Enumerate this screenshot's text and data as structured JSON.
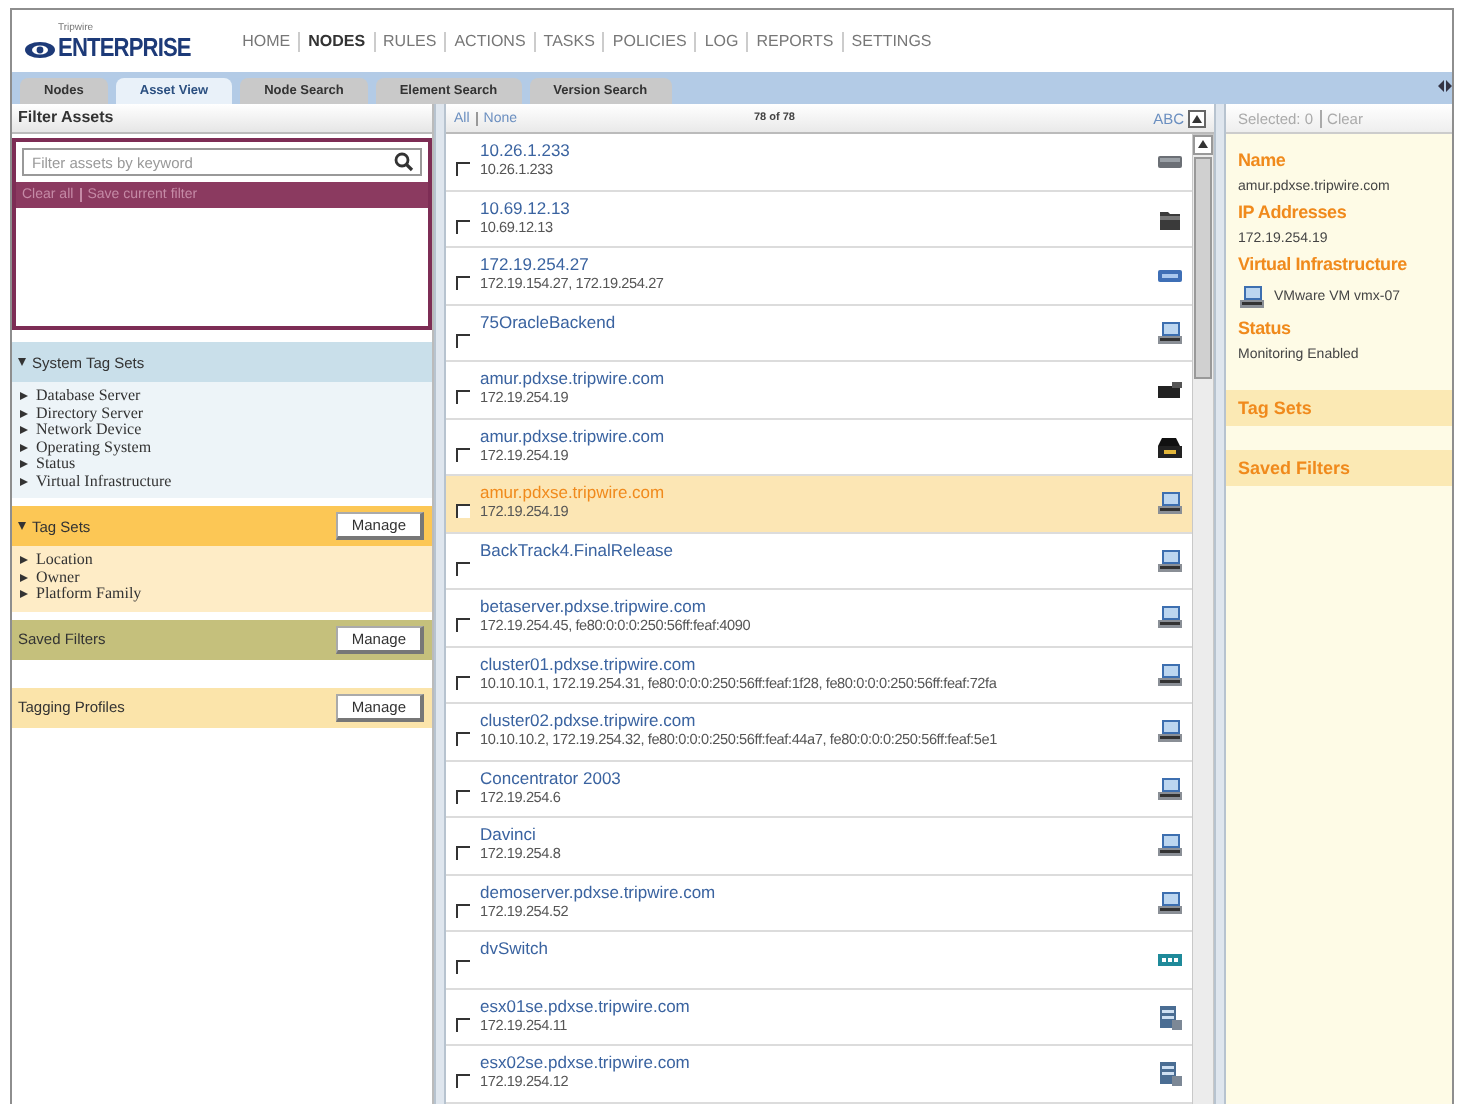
{
  "header": {
    "brand_small": "Tripwire",
    "brand": "ENTERPRISE",
    "nav": [
      {
        "label": "HOME",
        "selected": false
      },
      {
        "label": "NODES",
        "selected": true
      },
      {
        "label": "RULES",
        "selected": false
      },
      {
        "label": "ACTIONS",
        "selected": false
      },
      {
        "label": "TASKS",
        "selected": false
      },
      {
        "label": "POLICIES",
        "selected": false
      },
      {
        "label": "LOG",
        "selected": false
      },
      {
        "label": "REPORTS",
        "selected": false
      },
      {
        "label": "SETTINGS",
        "selected": false
      }
    ]
  },
  "tabs": [
    {
      "label": "Nodes",
      "selected": false
    },
    {
      "label": "Asset View",
      "selected": true
    },
    {
      "label": "Node Search",
      "selected": false
    },
    {
      "label": "Element Search",
      "selected": false
    },
    {
      "label": "Version Search",
      "selected": false
    }
  ],
  "filter_panel": {
    "title": "Filter Assets",
    "search": {
      "placeholder": "Filter assets by keyword"
    },
    "links": [
      "Clear all",
      "Save current filter"
    ],
    "sections": [
      {
        "title": "System Tag Sets",
        "color": "#c9dfea",
        "expanded": true,
        "items": [
          "Database Server",
          "Directory Server",
          "Network Device",
          "Operating System",
          "Status",
          "Virtual Infrastructure"
        ]
      },
      {
        "title": "Tag Sets",
        "color": "#fcc755",
        "expanded": true,
        "button": "Manage",
        "items": [
          "Location",
          "Owner",
          "Platform Family"
        ]
      },
      {
        "title": "Saved Filters",
        "color": "#c5c07c",
        "button": "Manage"
      },
      {
        "title": "Tagging Profiles",
        "color": "#fbe4aa",
        "button": "Manage"
      }
    ]
  },
  "asset_list": {
    "select_links": [
      "All",
      "None"
    ],
    "count": "78 of 78",
    "sort": "ABC",
    "rows": [
      {
        "name": "10.26.1.233",
        "ips": "10.26.1.233",
        "kind": "drive",
        "checked": false,
        "selected": false
      },
      {
        "name": "10.69.12.13",
        "ips": "10.69.12.13",
        "kind": "folder",
        "checked": false,
        "selected": false
      },
      {
        "name": "172.19.254.27",
        "ips": "172.19.154.27, 172.19.254.27",
        "kind": "card",
        "checked": false,
        "selected": false
      },
      {
        "name": "75OracleBackend",
        "kind": "vm",
        "checked": false,
        "selected": false
      },
      {
        "name": "amur.pdxse.tripwire.com",
        "ips": "172.19.254.19",
        "kind": "tape",
        "checked": false,
        "selected": false
      },
      {
        "name": "amur.pdxse.tripwire.com",
        "ips": "172.19.254.19",
        "kind": "printer",
        "checked": false,
        "selected": false
      },
      {
        "name": "amur.pdxse.tripwire.com",
        "ips": "172.19.254.19",
        "kind": "vm",
        "checked": false,
        "selected": true
      },
      {
        "name": "BackTrack4.FinalRelease",
        "kind": "vm",
        "checked": false,
        "selected": false
      },
      {
        "name": "betaserver.pdxse.tripwire.com",
        "ips": "172.19.254.45, fe80:0:0:0:250:56ff:feaf:4090",
        "kind": "vm",
        "checked": false,
        "selected": false
      },
      {
        "name": "cluster01.pdxse.tripwire.com",
        "ips": "10.10.10.1, 172.19.254.31, fe80:0:0:0:250:56ff:feaf:1f28, fe80:0:0:0:250:56ff:feaf:72fa",
        "kind": "vm",
        "checked": false,
        "selected": false
      },
      {
        "name": "cluster02.pdxse.tripwire.com",
        "ips": "10.10.10.2, 172.19.254.32, fe80:0:0:0:250:56ff:feaf:44a7, fe80:0:0:0:250:56ff:feaf:5e1",
        "kind": "vm",
        "checked": false,
        "selected": false
      },
      {
        "name": "Concentrator 2003",
        "ips": "172.19.254.6",
        "kind": "vm",
        "checked": false,
        "selected": false
      },
      {
        "name": "Davinci",
        "ips": "172.19.254.8",
        "kind": "vm",
        "checked": false,
        "selected": false
      },
      {
        "name": "demoserver.pdxse.tripwire.com",
        "ips": "172.19.254.52",
        "kind": "vm",
        "checked": false,
        "selected": false
      },
      {
        "name": "dvSwitch",
        "kind": "switch",
        "checked": false,
        "selected": false
      },
      {
        "name": "esx01se.pdxse.tripwire.com",
        "ips": "172.19.254.11",
        "kind": "host",
        "checked": false,
        "selected": false
      },
      {
        "name": "esx02se.pdxse.tripwire.com",
        "ips": "172.19.254.12",
        "kind": "host",
        "checked": false,
        "selected": false
      }
    ]
  },
  "details": {
    "selected_label": "Selected: 0",
    "clear": "Clear",
    "fields": [
      {
        "label": "Name",
        "value": "amur.pdxse.tripwire.com"
      },
      {
        "label": "IP Addresses",
        "value": "172.19.254.19"
      },
      {
        "label": "Virtual Infrastructure",
        "value": "VMware VM vmx-07",
        "kind": "vm"
      },
      {
        "label": "Status",
        "value": "Monitoring Enabled"
      }
    ],
    "sections": [
      "Tag Sets",
      "Saved Filters"
    ]
  }
}
